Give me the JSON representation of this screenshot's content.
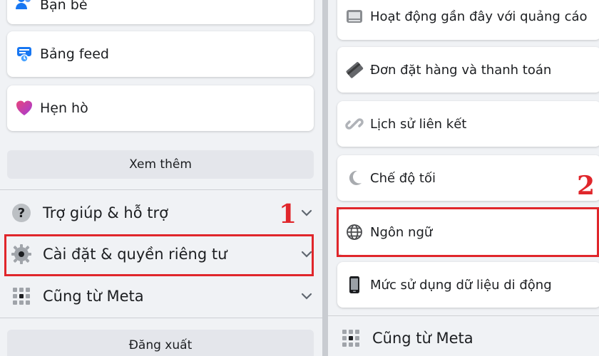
{
  "left": {
    "cards": [
      {
        "label": "Bạn bè",
        "icon": "friends-icon"
      },
      {
        "label": "Bảng feed",
        "icon": "feed-icon"
      },
      {
        "label": "Hẹn hò",
        "icon": "heart-icon"
      }
    ],
    "see_more": "Xem thêm",
    "rows": [
      {
        "label": "Trợ giúp & hỗ trợ",
        "icon": "help-icon"
      },
      {
        "label": "Cài đặt & quyền riêng tư",
        "icon": "gear-icon"
      },
      {
        "label": "Cũng từ Meta",
        "icon": "grid-icon"
      }
    ],
    "logout": "Đăng xuất",
    "annotation": "1"
  },
  "right": {
    "items": [
      {
        "label": "Hoạt động gần đây với quảng cáo",
        "icon": "ad-activity-icon"
      },
      {
        "label": "Đơn đặt hàng và thanh toán",
        "icon": "card-icon"
      },
      {
        "label": "Lịch sử liên kết",
        "icon": "link-icon"
      },
      {
        "label": "Chế độ tối",
        "icon": "moon-icon"
      },
      {
        "label": "Ngôn ngữ",
        "icon": "globe-icon"
      },
      {
        "label": "Mức sử dụng dữ liệu di động",
        "icon": "phone-icon"
      }
    ],
    "meta_row": "Cũng từ Meta",
    "annotation": "2"
  },
  "colors": {
    "highlight": "#e0262b",
    "accent": "#1877f2"
  }
}
